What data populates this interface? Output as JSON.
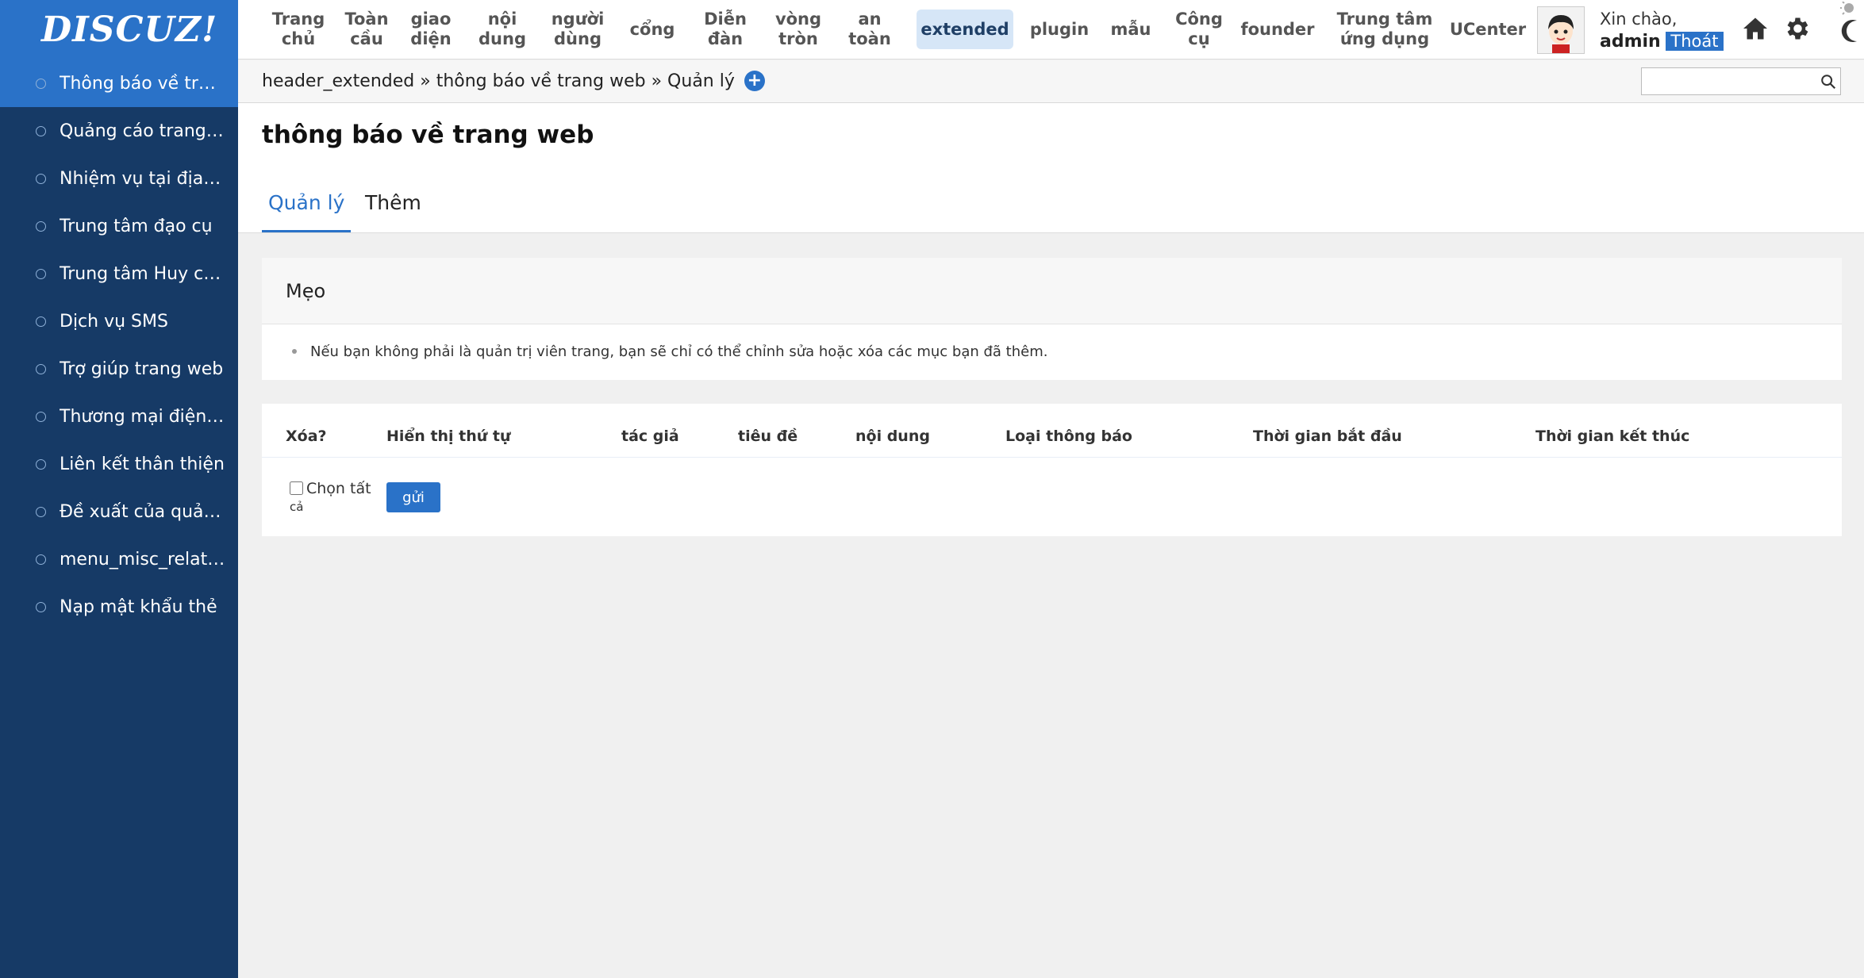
{
  "logo": {
    "text": "DISCUZ!"
  },
  "sidebar": {
    "items": [
      {
        "label": "Thông báo về tran..."
      },
      {
        "label": "Quảng cáo trang ..."
      },
      {
        "label": "Nhiệm vụ tại địa đi..."
      },
      {
        "label": "Trung tâm đạo cụ"
      },
      {
        "label": "Trung tâm Huy ch..."
      },
      {
        "label": "Dịch vụ SMS"
      },
      {
        "label": "Trợ giúp trang web"
      },
      {
        "label": "Thương mại điện tử"
      },
      {
        "label": "Liên kết thân thiện"
      },
      {
        "label": "Đề xuất của quản t..."
      },
      {
        "label": "menu_misc_relate..."
      },
      {
        "label": "Nạp mật khẩu thẻ"
      }
    ]
  },
  "topnav": {
    "items": [
      {
        "label": "Trang\nchủ"
      },
      {
        "label": "Toàn\ncầu"
      },
      {
        "label": "giao\ndiện"
      },
      {
        "label": "nội\ndung"
      },
      {
        "label": "người\ndùng"
      },
      {
        "label": "cổng"
      },
      {
        "label": "Diễn\nđàn"
      },
      {
        "label": "vòng\ntròn"
      },
      {
        "label": "an\ntoàn"
      },
      {
        "label": "extended"
      },
      {
        "label": "plugin"
      },
      {
        "label": "mẫu"
      },
      {
        "label": "Công\ncụ"
      },
      {
        "label": "founder"
      },
      {
        "label": "Trung tâm\nứng dụng"
      },
      {
        "label": "UCenter"
      }
    ]
  },
  "user": {
    "greeting": "Xin chào,",
    "name": "admin",
    "logout": "Thoát"
  },
  "breadcrumb": {
    "text": "header_extended » thông báo về trang web » Quản lý"
  },
  "page": {
    "title": "thông báo về trang web",
    "tabs": [
      {
        "label": "Quản lý"
      },
      {
        "label": "Thêm"
      }
    ]
  },
  "tip": {
    "title": "Mẹo",
    "text": "Nếu bạn không phải là quản trị viên trang, bạn sẽ chỉ có thể chỉnh sửa hoặc xóa các mục bạn đã thêm."
  },
  "table": {
    "headers": [
      "Xóa?",
      "Hiển thị thứ tự",
      "tác giả",
      "tiêu đề",
      "nội dung",
      "Loại thông báo",
      "Thời gian bắt đầu",
      "Thời gian kết thúc"
    ],
    "select_all": "Chọn tất",
    "select_all_cont": "cả",
    "submit": "gửi"
  },
  "colors": {
    "accent": "#2a72c8",
    "sidebar": "#163a66"
  }
}
